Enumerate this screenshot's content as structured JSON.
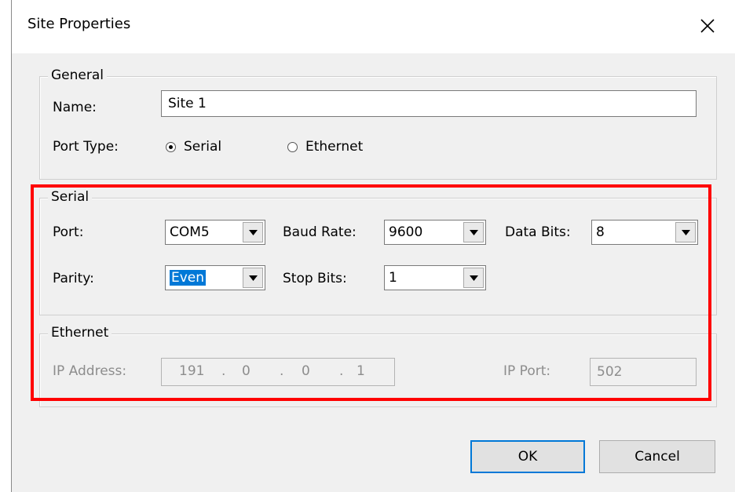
{
  "dialog": {
    "title": "Site Properties"
  },
  "general": {
    "legend": "General",
    "name_label": "Name:",
    "name_value": "Site 1",
    "port_type_label": "Port Type:",
    "radio_serial": "Serial",
    "radio_ethernet": "Ethernet",
    "port_type_selected": "Serial"
  },
  "serial": {
    "legend": "Serial",
    "port_label": "Port:",
    "port_value": "COM5",
    "baud_label": "Baud Rate:",
    "baud_value": "9600",
    "databits_label": "Data Bits:",
    "databits_value": "8",
    "parity_label": "Parity:",
    "parity_value": "Even",
    "stopbits_label": "Stop Bits:",
    "stopbits_value": "1"
  },
  "ethernet": {
    "legend": "Ethernet",
    "ip_label": "IP Address:",
    "ip": [
      "191",
      "0",
      "0",
      "1"
    ],
    "dot": ".",
    "port_label": "IP Port:",
    "port_value": "502"
  },
  "buttons": {
    "ok": "OK",
    "cancel": "Cancel"
  },
  "colors": {
    "highlight": "#ff0000",
    "selection": "#0078d7"
  }
}
